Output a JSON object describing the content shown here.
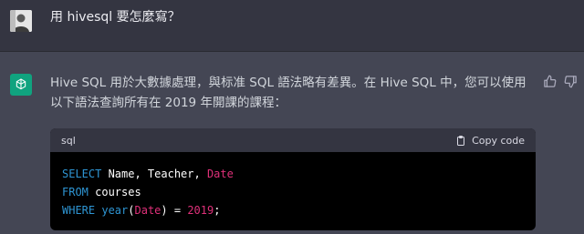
{
  "user": {
    "message": "用 hivesql 要怎麼寫？"
  },
  "assistant": {
    "message": "Hive SQL 用於大數據處理，與标准 SQL 語法略有差異。在 Hive SQL 中，您可以使用以下語法查詢所有在 2019 年開課的課程：",
    "code": {
      "language": "sql",
      "copy_label": "Copy code",
      "tokens": {
        "l1_kw": "SELECT",
        "l1_mid": " Name, Teacher, ",
        "l1_col": "Date",
        "l2_kw": "FROM",
        "l2_rest": " courses",
        "l3_kw": "WHERE",
        "l3_sp": " ",
        "l3_fn": "year",
        "l3_p1": "(",
        "l3_col": "Date",
        "l3_p2": ") = ",
        "l3_num": "2019",
        "l3_end": ";"
      }
    }
  },
  "icons": {
    "bot_avatar": "openai-logo-icon",
    "thumbs_up": "thumbs-up-icon",
    "thumbs_down": "thumbs-down-icon",
    "copy": "clipboard-icon"
  },
  "colors": {
    "page_bg": "#343541",
    "assistant_bg": "#444654",
    "bot_avatar_bg": "#10a37f",
    "keyword": "#2e95d3",
    "highlight": "#df3079"
  }
}
